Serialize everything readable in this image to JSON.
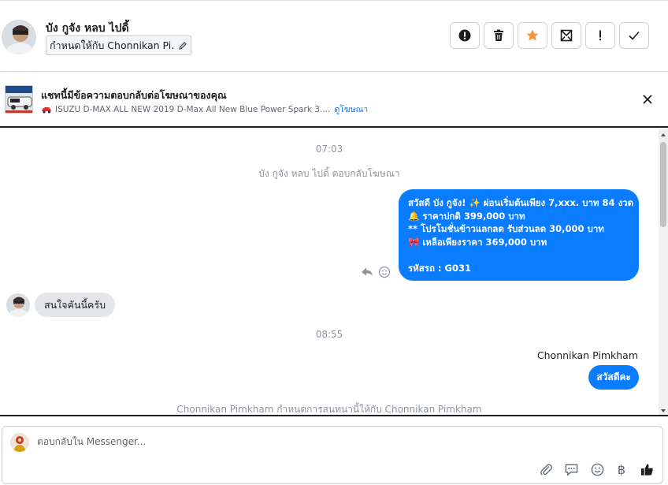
{
  "header": {
    "contact_name": "บัง กูจัง หลบ ไปดิ้",
    "assign_text": "กำหนดให้กับ Chonnikan Pi...",
    "actions": [
      {
        "icon": "alert-circle-icon"
      },
      {
        "icon": "trash-icon"
      },
      {
        "icon": "star-icon"
      },
      {
        "icon": "archive-envelope-icon"
      },
      {
        "icon": "exclamation-icon"
      },
      {
        "icon": "check-icon"
      }
    ],
    "accent_color": "#f7923b"
  },
  "ad_banner": {
    "title": "แชทนี้มีข้อความตอบกลับต่อโฆษณาของคุณ",
    "description": "ISUZU D-MAX ALL NEW 2019 D-Max All New Blue Power Spark 3....",
    "link": "ดูโฆษณา"
  },
  "conversation": {
    "time1": "07:03",
    "system1": "บัง กูจัง หลบ ไปดิ้ ตอบกลับโฆษณา",
    "outgoing_lines": [
      "สวัสดี บัง กูจัง! ✨ ผ่อนเริ่มต้นเพียง 7,xxx. บาท 84 งวด",
      "🔔 ราคาปกติ 399,000 บาท",
      "** โปรโมชั่นข้าวแลกลด รับส่วนลด 30,000 บาท",
      "🎀 เหลือเพียงราคา 369,000 บาท",
      "",
      "รหัสรถ : G031"
    ],
    "incoming_message": "สนใจคันนี้ครับ",
    "time2": "08:55",
    "sender_name": "Chonnikan Pimkham",
    "outgoing_reply": "สวัสดีคะ",
    "system2": "Chonnikan Pimkham กำหนดการสนทนานี้ให้กับ Chonnikan Pimkham",
    "bubble_color": "#0a7cff"
  },
  "composer": {
    "placeholder": "ตอบกลับใน Messenger...",
    "baht_symbol": "฿",
    "tools": [
      "attachment-icon",
      "quick-reply-icon",
      "emoji-icon",
      "baht-icon",
      "like-icon"
    ]
  }
}
